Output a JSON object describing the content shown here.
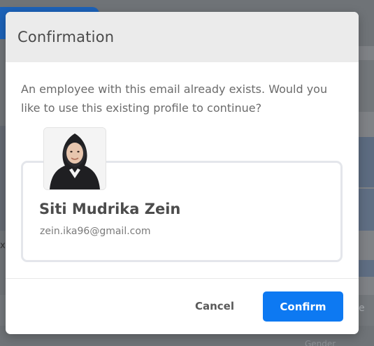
{
  "dialog": {
    "title": "Confirmation",
    "message": "An employee with this email already exists. Would you like to use this existing profile to continue?",
    "cancel_label": "Cancel",
    "confirm_label": "Confirm",
    "accent_color": "#0d79f2"
  },
  "employee": {
    "name": "Siti Mudrika Zein",
    "email": "zein.ika96@gmail.com",
    "avatar": "employee-photo"
  },
  "background": {
    "close_glyph": "x",
    "field_fragment": "e",
    "gender_label": "Gender"
  }
}
